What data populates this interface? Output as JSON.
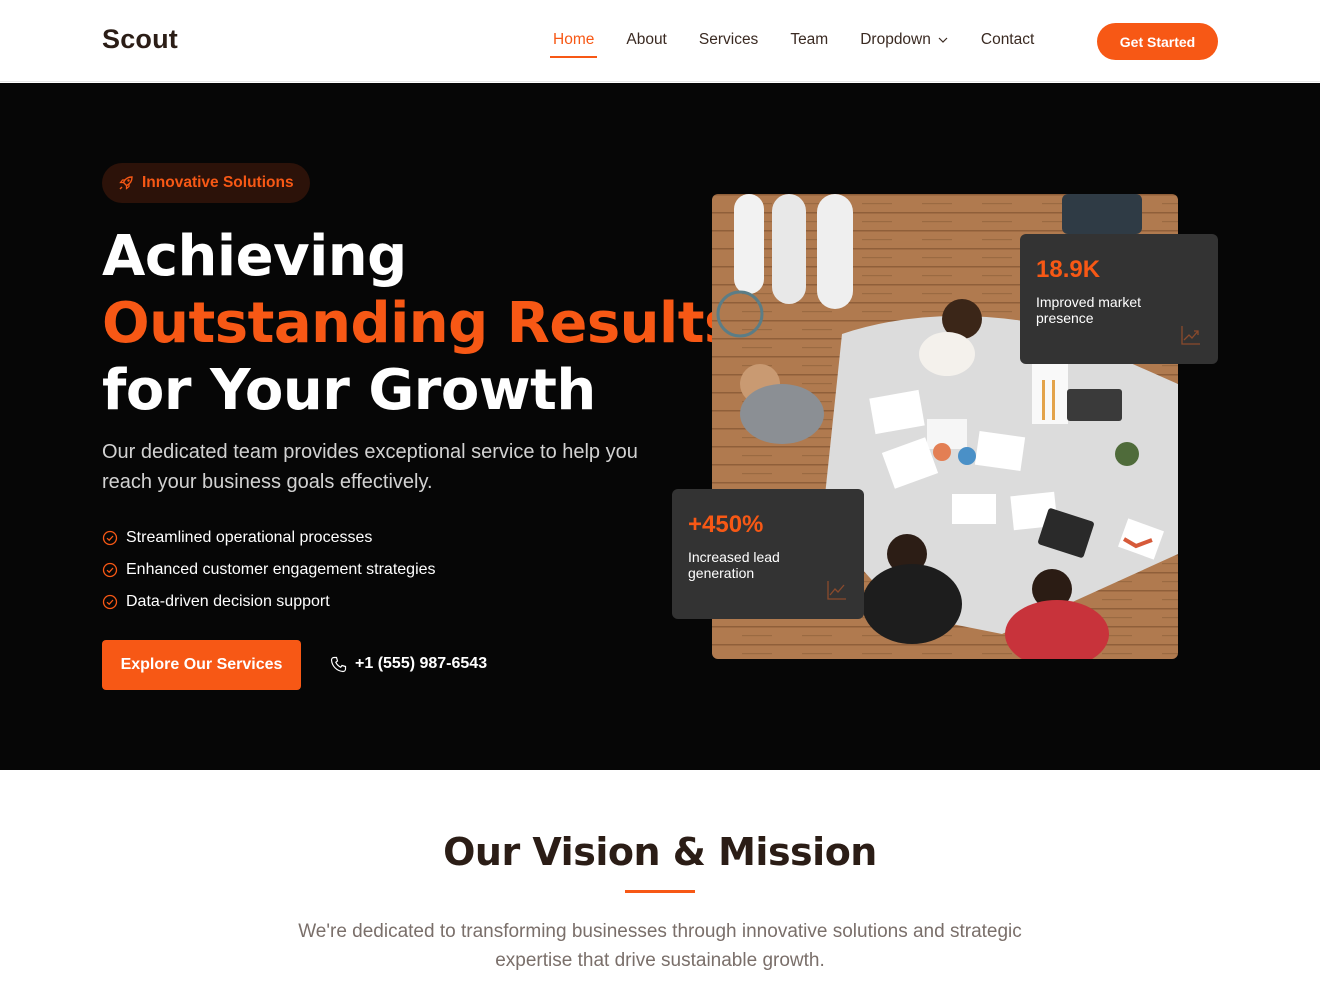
{
  "header": {
    "logo": "Scout",
    "nav": [
      "Home",
      "About",
      "Services",
      "Team",
      "Dropdown",
      "Contact"
    ],
    "active_nav": "Home",
    "cta": "Get Started"
  },
  "hero": {
    "badge": "Innovative Solutions",
    "headline_1": "Achieving",
    "headline_2": "Outstanding Results",
    "headline_3": "for Your Growth",
    "description": "Our dedicated team provides exceptional service to help you reach your business goals effectively.",
    "features": [
      "Streamlined operational processes",
      "Enhanced customer engagement strategies",
      "Data-driven decision support"
    ],
    "primary_button": "Explore Our Services",
    "phone": "+1 (555) 987-6543",
    "stats": [
      {
        "value": "18.9K",
        "label": "Improved market presence",
        "icon": "graph-up-arrow-icon"
      },
      {
        "value": "+450%",
        "label": "Increased lead generation",
        "icon": "graph-up-icon"
      }
    ]
  },
  "vision": {
    "title": "Our Vision & Mission",
    "description": "We're dedicated to transforming businesses through innovative solutions and strategic expertise that drive sustainable growth."
  },
  "colors": {
    "accent": "#f75815",
    "hero_bg": "#060606",
    "card_bg": "#333333",
    "text_dark": "#2b1d16"
  }
}
